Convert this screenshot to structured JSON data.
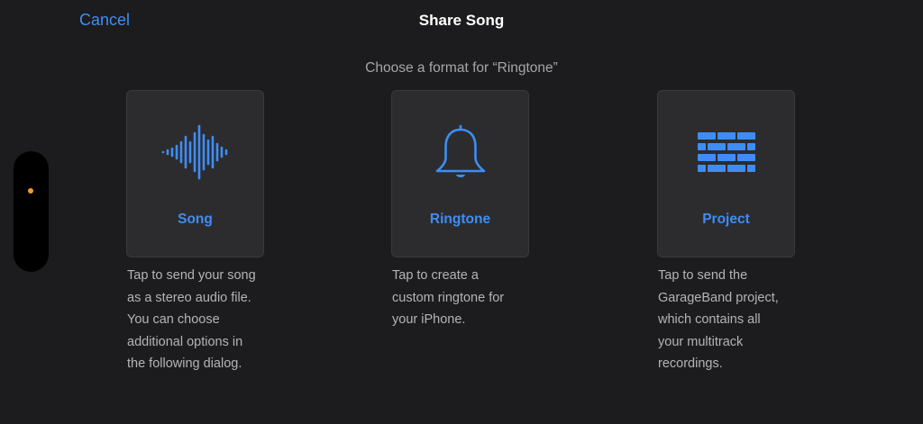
{
  "header": {
    "cancel_label": "Cancel",
    "title": "Share Song"
  },
  "subtitle": "Choose a format for “Ringtone”",
  "accent_color": "#3e8df5",
  "indicator_color": "#f09a36",
  "options": [
    {
      "label": "Song",
      "icon": "waveform-icon",
      "description_lines": [
        "Tap to send your song",
        "as a stereo audio file.",
        "You can choose",
        "additional options in",
        "the following dialog."
      ]
    },
    {
      "label": "Ringtone",
      "icon": "bell-icon",
      "description_lines": [
        "Tap to create a",
        "custom ringtone for",
        "your iPhone."
      ]
    },
    {
      "label": "Project",
      "icon": "bricks-icon",
      "description_lines": [
        "Tap to send the",
        "GarageBand project,",
        "which contains all",
        "your multitrack",
        "recordings."
      ]
    }
  ]
}
